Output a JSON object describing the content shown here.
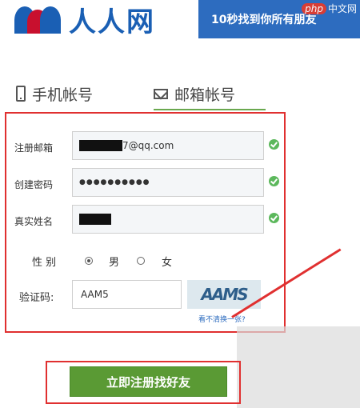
{
  "header": {
    "logo_text": "人人网",
    "banner_text": "10秒找到你所有朋友",
    "watermark_badge": "php",
    "watermark_text": "中文网"
  },
  "tabs": [
    {
      "label": "手机帐号",
      "icon": "phone-icon",
      "active": false
    },
    {
      "label": "邮箱帐号",
      "icon": "mail-icon",
      "active": true
    }
  ],
  "form": {
    "email": {
      "label": "注册邮箱",
      "value_suffix": "7@qq.com",
      "valid": true
    },
    "password": {
      "label": "创建密码",
      "value": "●●●●●●●●●●",
      "valid": true
    },
    "realname": {
      "label": "真实姓名",
      "valid": true
    },
    "gender": {
      "label": "性 别",
      "options": [
        "男",
        "女"
      ],
      "selected": "男"
    },
    "captcha": {
      "label": "验证码:",
      "value": "AAM5",
      "image_text": "AAMS",
      "refresh_label": "看不清换一张?"
    }
  },
  "submit": {
    "label": "立即注册找好友"
  },
  "colors": {
    "brand_blue": "#1a5fb4",
    "accent_green": "#5a9a34",
    "highlight_red": "#e03030",
    "check_green": "#5cb85c"
  }
}
